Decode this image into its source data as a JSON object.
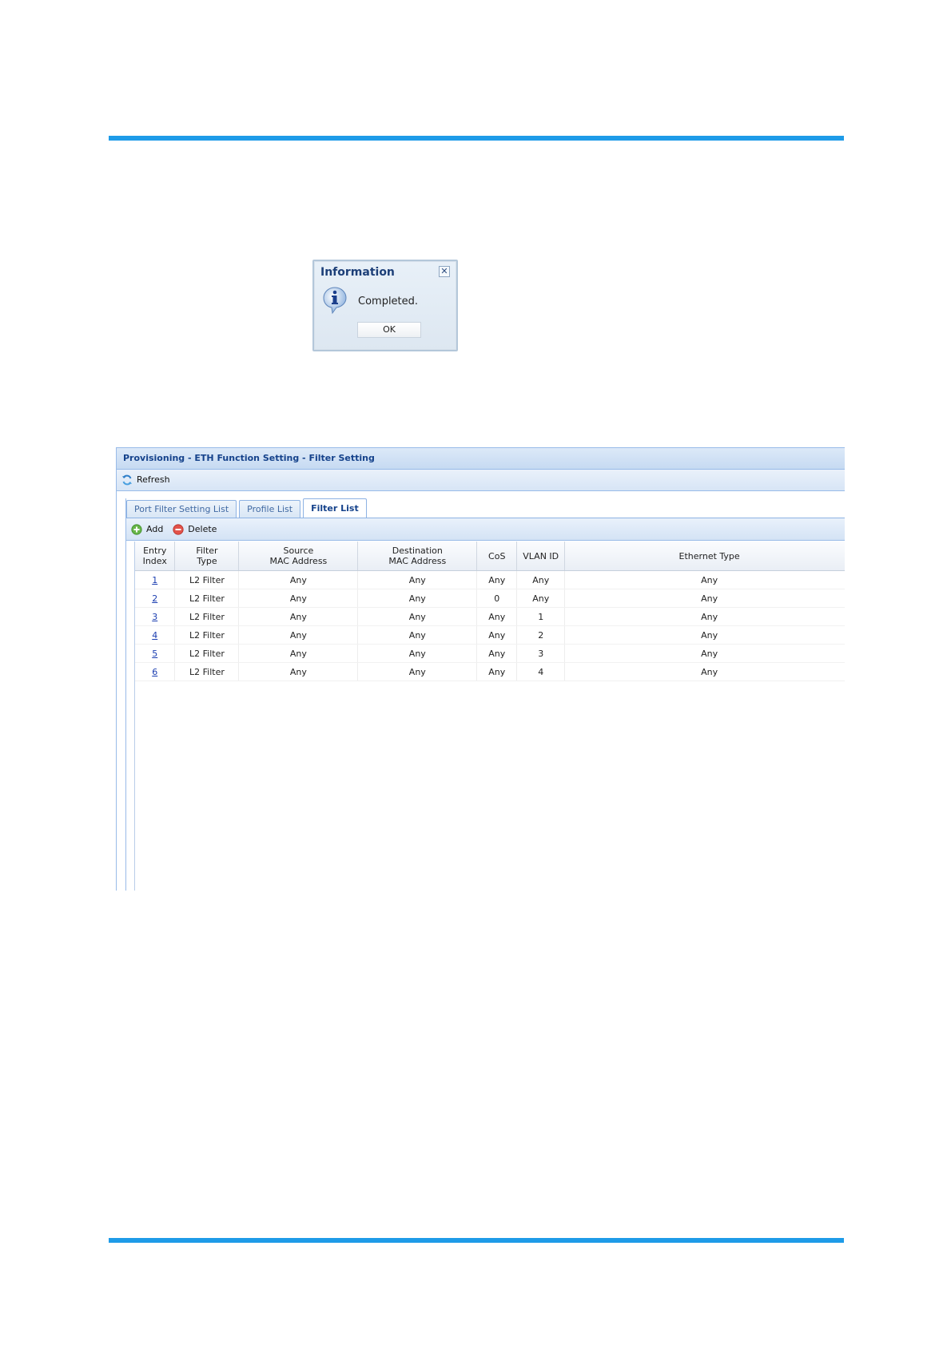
{
  "dialog": {
    "title": "Information",
    "close": "✕",
    "message": "Completed.",
    "ok": "OK"
  },
  "panel": {
    "header": "Provisioning - ETH Function Setting - Filter Setting",
    "refresh": "Refresh",
    "tabs": [
      {
        "label": "Port Filter Setting List"
      },
      {
        "label": "Profile List"
      },
      {
        "label": "Filter List"
      }
    ],
    "add": "Add",
    "delete": "Delete"
  },
  "table": {
    "columns": [
      {
        "l1": "Entry",
        "l2": "Index"
      },
      {
        "l1": "Filter",
        "l2": "Type"
      },
      {
        "l1": "Source",
        "l2": "MAC Address"
      },
      {
        "l1": "Destination",
        "l2": "MAC Address"
      },
      {
        "l1": "CoS",
        "l2": ""
      },
      {
        "l1": "VLAN ID",
        "l2": ""
      },
      {
        "l1": "Ethernet Type",
        "l2": ""
      }
    ],
    "rows": [
      [
        "1",
        "L2 Filter",
        "Any",
        "Any",
        "Any",
        "Any",
        "Any"
      ],
      [
        "2",
        "L2 Filter",
        "Any",
        "Any",
        "0",
        "Any",
        "Any"
      ],
      [
        "3",
        "L2 Filter",
        "Any",
        "Any",
        "Any",
        "1",
        "Any"
      ],
      [
        "4",
        "L2 Filter",
        "Any",
        "Any",
        "Any",
        "2",
        "Any"
      ],
      [
        "5",
        "L2 Filter",
        "Any",
        "Any",
        "Any",
        "3",
        "Any"
      ],
      [
        "6",
        "L2 Filter",
        "Any",
        "Any",
        "Any",
        "4",
        "Any"
      ]
    ]
  }
}
